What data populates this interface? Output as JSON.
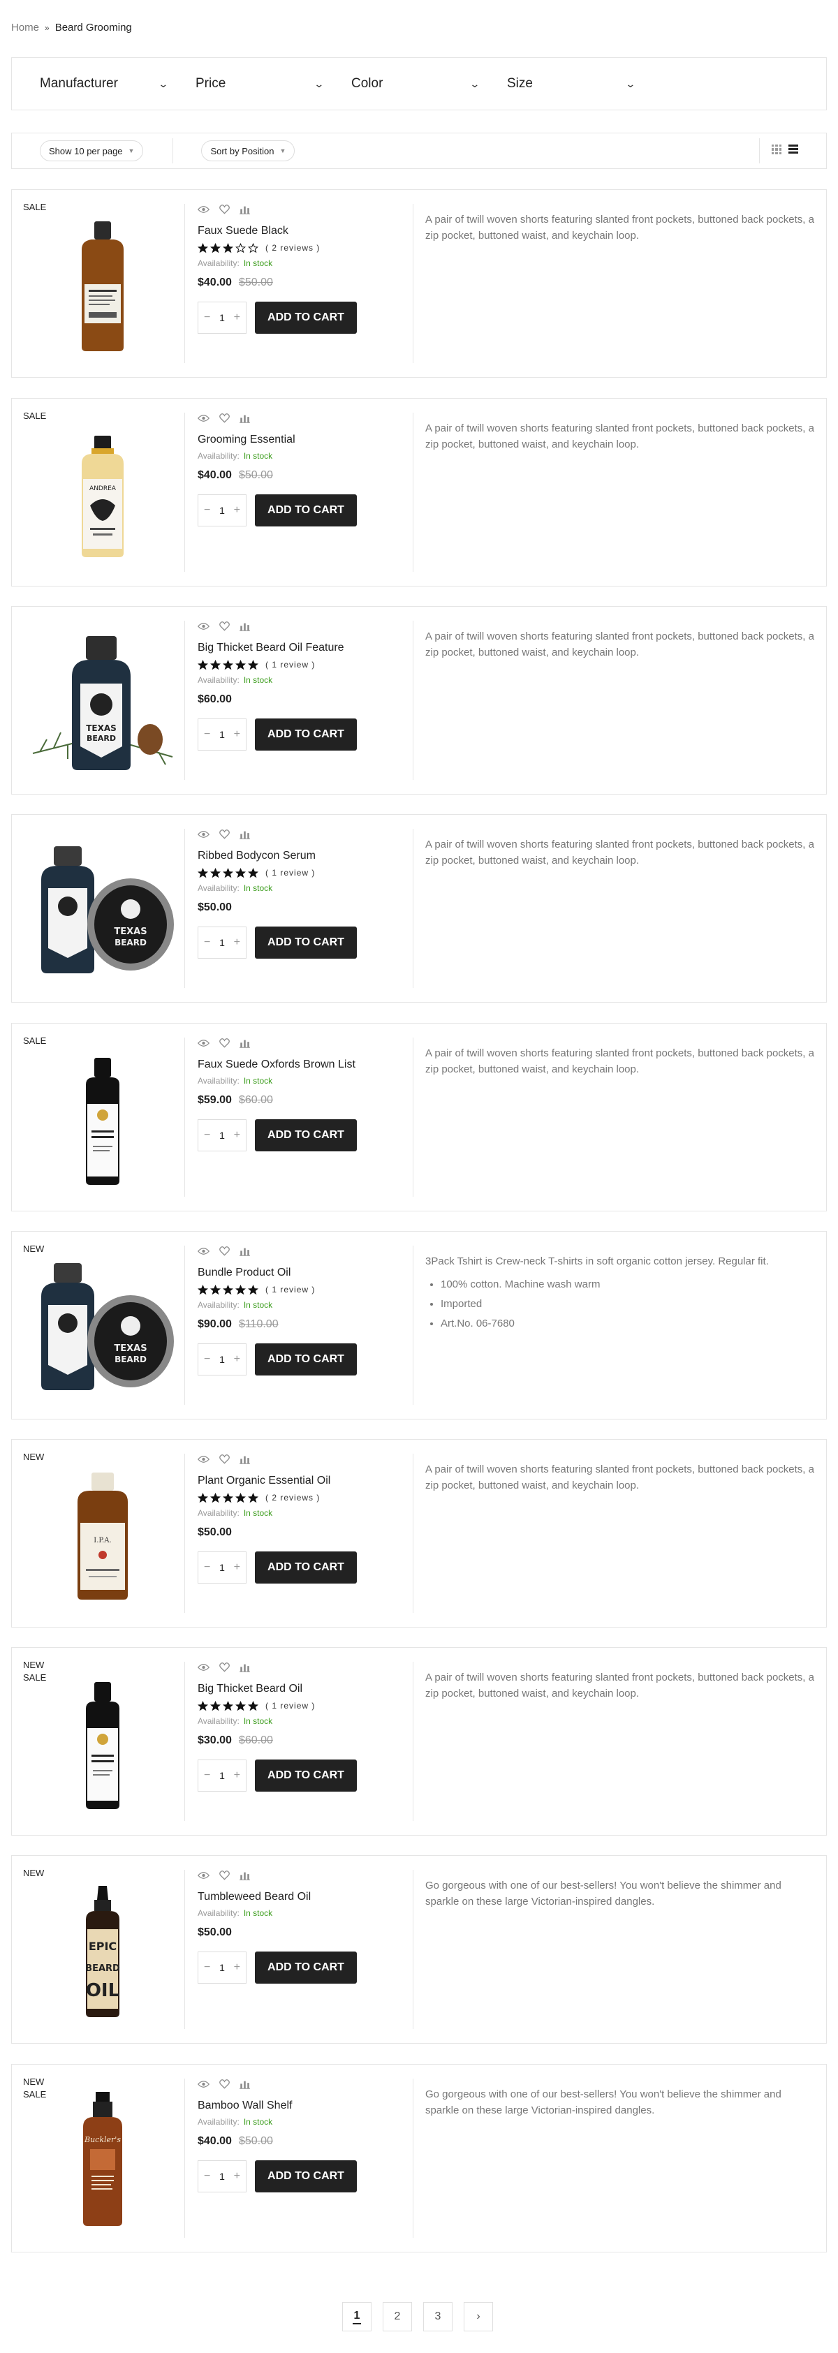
{
  "breadcrumb": {
    "home": "Home",
    "current": "Beard Grooming"
  },
  "filters": [
    {
      "label": "Manufacturer"
    },
    {
      "label": "Price"
    },
    {
      "label": "Color"
    },
    {
      "label": "Size"
    }
  ],
  "toolbar": {
    "per_page": "Show 10 per page",
    "sort": "Sort by Position",
    "view_modes": [
      "grid-icon",
      "list-icon"
    ],
    "active_view": "list"
  },
  "add_to_cart_label": "ADD TO CART",
  "availability_label": "Availability:",
  "products": [
    {
      "badges": [
        "SALE"
      ],
      "name": "Faux Suede Black",
      "rating": 3,
      "reviews": "2 reviews",
      "availability": "In stock",
      "price": "$40.00",
      "old_price": "$50.00",
      "qty": "1",
      "description": "A pair of twill woven shorts featuring slanted front pockets, buttoned back pockets, a zip pocket, buttoned waist, and keychain loop.",
      "bullets": []
    },
    {
      "badges": [
        "SALE"
      ],
      "name": "Grooming Essential",
      "rating": null,
      "reviews": "",
      "availability": "In stock",
      "price": "$40.00",
      "old_price": "$50.00",
      "qty": "1",
      "description": "A pair of twill woven shorts featuring slanted front pockets, buttoned back pockets, a zip pocket, buttoned waist, and keychain loop.",
      "bullets": []
    },
    {
      "badges": [],
      "name": "Big Thicket Beard Oil Feature",
      "rating": 5,
      "reviews": "1 review",
      "availability": "In stock",
      "price": "$60.00",
      "old_price": "",
      "qty": "1",
      "description": "A pair of twill woven shorts featuring slanted front pockets, buttoned back pockets, a zip pocket, buttoned waist, and keychain loop.",
      "bullets": []
    },
    {
      "badges": [],
      "name": "Ribbed Bodycon Serum",
      "rating": 5,
      "reviews": "1 review",
      "availability": "In stock",
      "price": "$50.00",
      "old_price": "",
      "qty": "1",
      "description": "A pair of twill woven shorts featuring slanted front pockets, buttoned back pockets, a zip pocket, buttoned waist, and keychain loop.",
      "bullets": []
    },
    {
      "badges": [
        "SALE"
      ],
      "name": "Faux Suede Oxfords Brown List",
      "rating": null,
      "reviews": "",
      "availability": "In stock",
      "price": "$59.00",
      "old_price": "$60.00",
      "qty": "1",
      "description": "A pair of twill woven shorts featuring slanted front pockets, buttoned back pockets, a zip pocket, buttoned waist, and keychain loop.",
      "bullets": []
    },
    {
      "badges": [
        "NEW"
      ],
      "name": "Bundle Product Oil",
      "rating": 5,
      "reviews": "1 review",
      "availability": "In stock",
      "price": "$90.00",
      "old_price": "$110.00",
      "qty": "1",
      "description": "3Pack Tshirt is Crew-neck T-shirts in soft organic cotton jersey. Regular fit.",
      "bullets": [
        "100% cotton. Machine wash warm",
        "Imported",
        "Art.No. 06-7680"
      ]
    },
    {
      "badges": [
        "NEW"
      ],
      "name": "Plant Organic Essential Oil",
      "rating": 5,
      "reviews": "2 reviews",
      "availability": "In stock",
      "price": "$50.00",
      "old_price": "",
      "qty": "1",
      "description": "A pair of twill woven shorts featuring slanted front pockets, buttoned back pockets, a zip pocket, buttoned waist, and keychain loop.",
      "bullets": []
    },
    {
      "badges": [
        "NEW",
        "SALE"
      ],
      "name": "Big Thicket Beard Oil",
      "rating": 5,
      "reviews": "1 review",
      "availability": "In stock",
      "price": "$30.00",
      "old_price": "$60.00",
      "qty": "1",
      "description": "A pair of twill woven shorts featuring slanted front pockets, buttoned back pockets, a zip pocket, buttoned waist, and keychain loop.",
      "bullets": []
    },
    {
      "badges": [
        "NEW"
      ],
      "name": "Tumbleweed Beard Oil",
      "rating": null,
      "reviews": "",
      "availability": "In stock",
      "price": "$50.00",
      "old_price": "",
      "qty": "1",
      "description": "Go gorgeous with one of our best-sellers! You won't believe the shimmer and sparkle on these large Victorian-inspired dangles.",
      "bullets": []
    },
    {
      "badges": [
        "NEW",
        "SALE"
      ],
      "name": "Bamboo Wall Shelf",
      "rating": null,
      "reviews": "",
      "availability": "In stock",
      "price": "$40.00",
      "old_price": "$50.00",
      "qty": "1",
      "description": "Go gorgeous with one of our best-sellers! You won't believe the shimmer and sparkle on these large Victorian-inspired dangles.",
      "bullets": []
    }
  ],
  "pagination": {
    "pages": [
      "1",
      "2",
      "3"
    ],
    "current": "1",
    "next": "›"
  },
  "colors": {
    "accent": "#222222",
    "in_stock": "#3c9d1d",
    "border": "#e5e5e5"
  }
}
